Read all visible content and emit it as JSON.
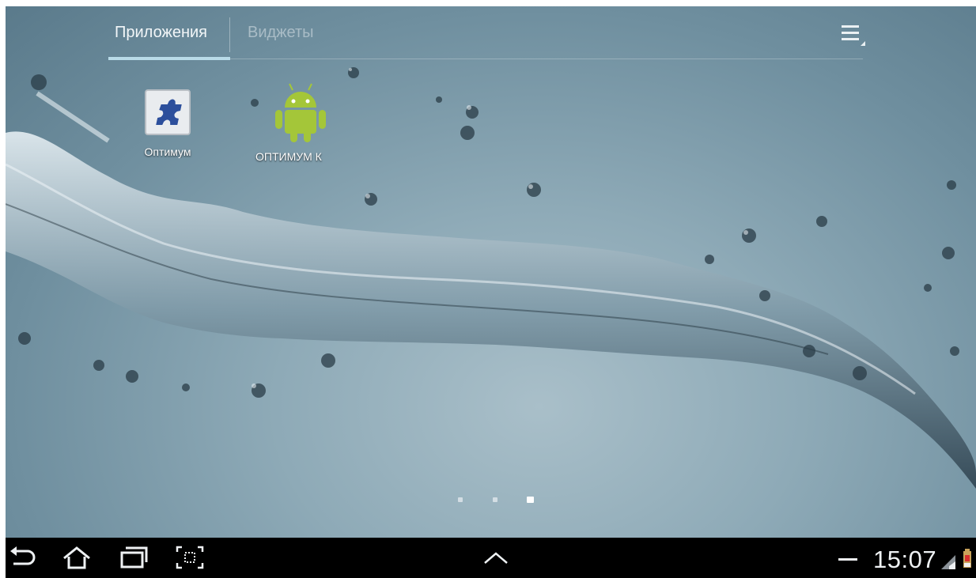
{
  "tabs": {
    "apps_label": "Приложения",
    "widgets_label": "Виджеты"
  },
  "apps": [
    {
      "label": "Оптимум",
      "icon": "puzzle-icon"
    },
    {
      "label": "ОПТИМУМ К",
      "icon": "android-icon"
    }
  ],
  "pages": {
    "count": 3,
    "active_index": 2
  },
  "status_bar": {
    "time": "15:07",
    "signal_icon": "signal-icon",
    "battery_icon": "battery-alert-icon"
  },
  "nav": {
    "icons": [
      "back-icon",
      "home-icon",
      "recent-apps-icon",
      "screenshot-icon",
      "chevron-up-icon",
      "minimize-icon"
    ]
  },
  "colors": {
    "tab_indicator": "#b9dbe8",
    "navbar": "#000000",
    "android_green": "#a4c639"
  }
}
